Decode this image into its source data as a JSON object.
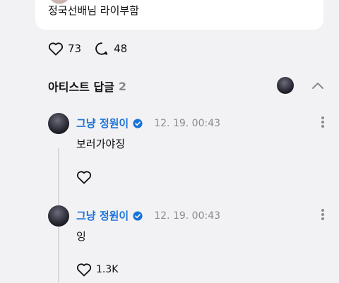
{
  "post": {
    "text": "정국선배님 라이부함",
    "likes": "73",
    "comments": "48"
  },
  "artist_section": {
    "title": "아티스트 답글",
    "count": "2"
  },
  "replies": [
    {
      "name": "그냥 정원이",
      "time": "12. 19. 00:43",
      "text": "보러가야징",
      "likes": ""
    },
    {
      "name": "그냥 정원이",
      "time": "12. 19. 00:43",
      "text": "잉",
      "likes": "1.3K"
    }
  ],
  "colors": {
    "background": "#f2f2f5",
    "name_blue": "#1a73d9",
    "verified": "#1a73d9",
    "muted": "#8a8a8f"
  }
}
